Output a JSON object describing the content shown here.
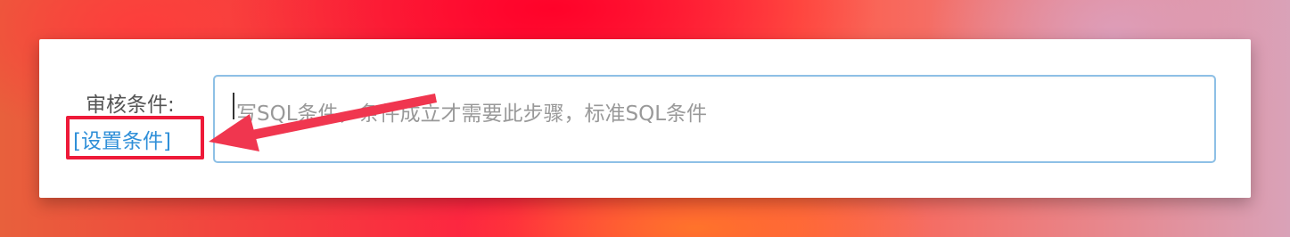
{
  "form": {
    "label": "审核条件:",
    "set_condition_link": "[设置条件]",
    "sql_input": {
      "placeholder": "写SQL条件，条件成立才需要此步骤，标准SQL条件",
      "value": ""
    }
  },
  "annotation": {
    "highlight_color": "#ee1a39",
    "arrow_color": "#f0364f"
  },
  "colors": {
    "link": "#2f8fd8",
    "input_border": "#8ec0e6",
    "label": "#555555",
    "placeholder": "#999999"
  }
}
